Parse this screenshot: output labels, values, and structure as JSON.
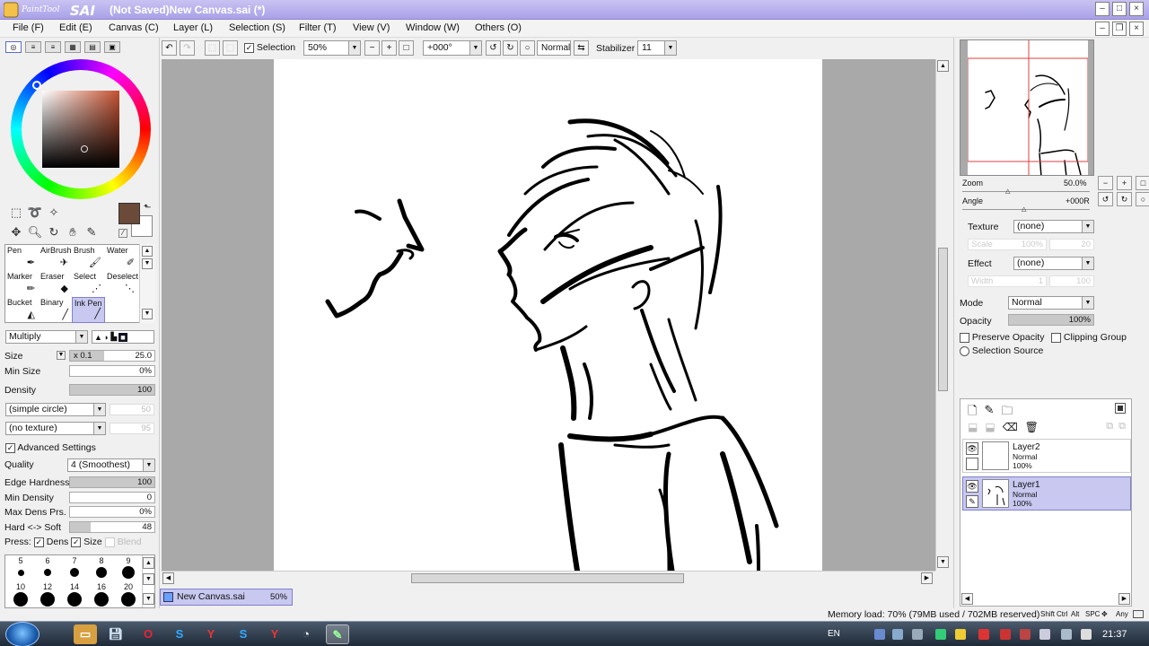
{
  "window": {
    "app_name": "PaintTool SAI",
    "title": "(Not Saved)New Canvas.sai (*)"
  },
  "menu": {
    "items": [
      "File (F)",
      "Edit (E)",
      "Canvas (C)",
      "Layer (L)",
      "Selection (S)",
      "Filter (T)",
      "View (V)",
      "Window (W)",
      "Others (O)"
    ]
  },
  "toolbar": {
    "selection_label": "Selection",
    "selection_checked": true,
    "zoom": "50%",
    "rotation": "+000°",
    "mode": "Normal",
    "stabilizer_label": "Stabilizer",
    "stabilizer": "11"
  },
  "colors": {
    "foreground": "#6b4a3a",
    "background": "#ffffff",
    "accent": "#c8c8f0"
  },
  "tools": {
    "brushes": [
      {
        "label": "Pen",
        "icon": "pen-icon"
      },
      {
        "label": "AirBrush",
        "icon": "airbrush-icon"
      },
      {
        "label": "Brush",
        "icon": "brush-icon"
      },
      {
        "label": "Water",
        "icon": "water-icon"
      },
      {
        "label": "Marker",
        "icon": "marker-icon"
      },
      {
        "label": "Eraser",
        "icon": "eraser-icon"
      },
      {
        "label": "Select",
        "icon": "select-icon"
      },
      {
        "label": "Deselect",
        "icon": "deselect-icon"
      },
      {
        "label": "Bucket",
        "icon": "bucket-icon"
      },
      {
        "label": "Binary",
        "icon": "binary-icon"
      },
      {
        "label": "Ink Pen",
        "icon": "ink-pen-icon"
      }
    ],
    "selected": "Ink Pen"
  },
  "brush": {
    "blend_mode": "Multiply",
    "size_label": "Size",
    "size_mult": "x 0.1",
    "size": "25.0",
    "min_size_label": "Min Size",
    "min_size": "0%",
    "density_label": "Density",
    "density": "100",
    "shape": "(simple circle)",
    "shape_val": "50",
    "texture": "(no texture)",
    "texture_val": "95",
    "advanced_label": "Advanced Settings",
    "quality_label": "Quality",
    "quality": "4 (Smoothest)",
    "edge_hardness_label": "Edge Hardness",
    "edge_hardness": "100",
    "min_density_label": "Min Density",
    "min_density": "0",
    "max_dens_prs_label": "Max Dens Prs.",
    "max_dens_prs": "0%",
    "hard_soft_label": "Hard <-> Soft",
    "hard_soft": "48",
    "press_label": "Press:",
    "press_dens": "Dens",
    "press_size": "Size",
    "press_blend": "Blend"
  },
  "brush_sizes": [
    "5",
    "6",
    "7",
    "8",
    "9",
    "10",
    "12",
    "14",
    "16",
    "20"
  ],
  "canvas_tab": {
    "name": "New Canvas.sai",
    "zoom": "50%"
  },
  "navigator": {
    "zoom_label": "Zoom",
    "zoom": "50.0%",
    "angle_label": "Angle",
    "angle": "+000R"
  },
  "layer_props": {
    "texture_label": "Texture",
    "texture": "(none)",
    "scale_label": "Scale",
    "scale_val": "100%",
    "scale_num": "20",
    "effect_label": "Effect",
    "effect": "(none)",
    "width_label": "Width",
    "width_val": "1",
    "width_num": "100",
    "mode_label": "Mode",
    "mode": "Normal",
    "opacity_label": "Opacity",
    "opacity": "100%",
    "preserve_opacity": "Preserve Opacity",
    "clipping_group": "Clipping Group",
    "selection_source": "Selection Source"
  },
  "layers": [
    {
      "name": "Layer2",
      "mode": "Normal",
      "opacity": "100%",
      "active": false
    },
    {
      "name": "Layer1",
      "mode": "Normal",
      "opacity": "100%",
      "active": true
    }
  ],
  "status": {
    "memory": "Memory load: 70% (79MB used / 702MB reserved)",
    "keys": [
      "Shift",
      "Ctrl",
      "Alt",
      "SPC",
      "Any"
    ]
  },
  "taskbar": {
    "lang": "EN",
    "clock": "21:37"
  }
}
